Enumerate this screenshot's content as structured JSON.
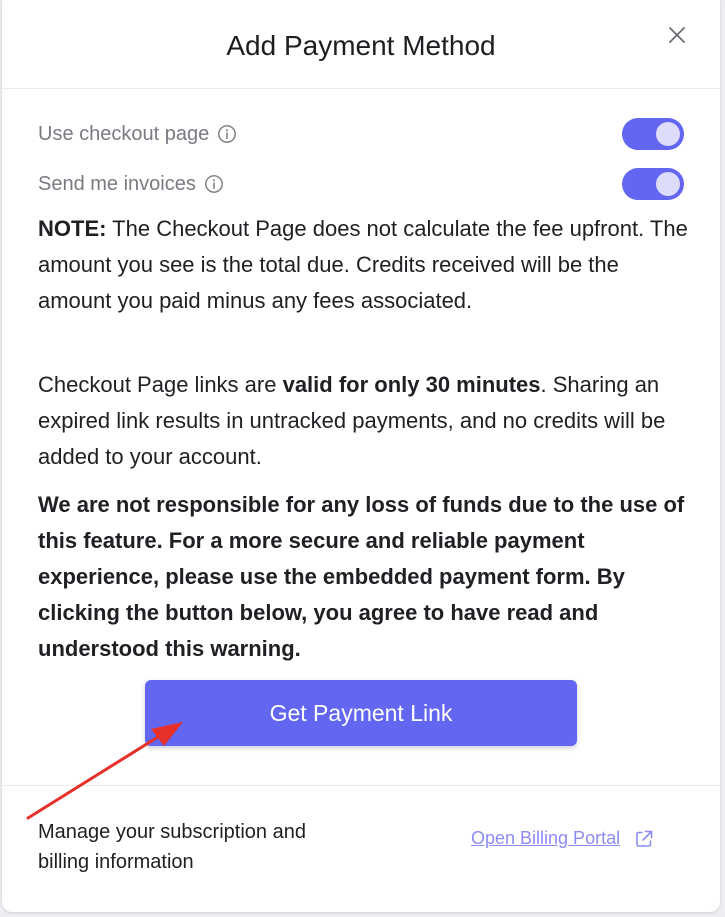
{
  "modal": {
    "title": "Add Payment Method"
  },
  "toggles": [
    {
      "label": "Use checkout page",
      "checked": true
    },
    {
      "label": "Send me invoices",
      "checked": true
    }
  ],
  "note": {
    "prefix": "NOTE:",
    "text": " The Checkout Page does not calculate the fee upfront. The amount you see is the total due. Credits received will be the amount you paid minus any fees associated."
  },
  "links_info": {
    "before": "Checkout Page links are ",
    "bold": "valid for only 30 minutes",
    "after": ". Sharing an expired link results in untracked payments, and no credits will be added to your account."
  },
  "warning": "We are not responsible for any loss of funds due to the use of this feature. For a more secure and reliable payment experience, please use the embedded payment form. By clicking the button below, you agree to have read and understood this warning.",
  "button": {
    "label": "Get Payment Link"
  },
  "footer": {
    "text": "Manage your subscription and billing information",
    "portal_label": "Open Billing Portal"
  },
  "colors": {
    "accent": "#6366f1",
    "link": "#8b8cf2",
    "annotation": "#e8302a"
  },
  "icons": [
    "close-icon",
    "info-icon",
    "external-link-icon",
    "arrow-annotation"
  ]
}
